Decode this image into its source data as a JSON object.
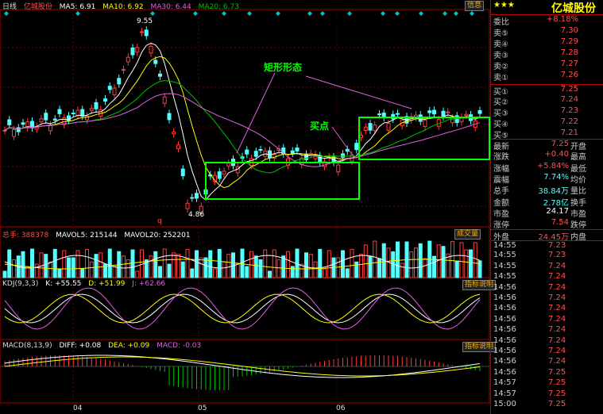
{
  "header": {
    "period": "日线",
    "stock": "亿城股份",
    "ma5": "MA5: 6.91",
    "ma10": "MA10: 6.92",
    "ma30": "MA30: 6.44",
    "ma20": "MA20: 6.73",
    "info_btn": "信息"
  },
  "annotations": {
    "pattern": "矩形形态",
    "buy": "买点",
    "high": "9.55",
    "low": "4.86",
    "q_marker": "q"
  },
  "volume_header": {
    "label": "总手: 388378",
    "mavol5": "MAVOL5: 215144",
    "mavol20": "MAVOL20: 252201",
    "btn": "成交量"
  },
  "kdj_header": {
    "label": "KDJ(9,3,3)",
    "k": "K: +55.55",
    "d": "D: +51.99",
    "j": "J: +62.66",
    "btn": "指标说明"
  },
  "macd_header": {
    "label": "MACD(8,13,9)",
    "diff": "DIFF: +0.08",
    "dea": "DEA: +0.09",
    "macd": "MACD: -0.03",
    "btn": "指标说明"
  },
  "xaxis": [
    "04",
    "05",
    "06"
  ],
  "side": {
    "stars": "★★★",
    "title": "亿城股份",
    "ratio_label": "委比",
    "ratio_value": "+8.18%",
    "asks": [
      {
        "label": "卖⑤",
        "price": "7.30"
      },
      {
        "label": "卖④",
        "price": "7.29"
      },
      {
        "label": "卖③",
        "price": "7.28"
      },
      {
        "label": "卖②",
        "price": "7.27"
      },
      {
        "label": "卖①",
        "price": "7.26"
      }
    ],
    "bids": [
      {
        "label": "买①",
        "price": "7.25"
      },
      {
        "label": "买②",
        "price": "7.24"
      },
      {
        "label": "买③",
        "price": "7.23"
      },
      {
        "label": "买④",
        "price": "7.22"
      },
      {
        "label": "买⑤",
        "price": "7.21"
      }
    ],
    "stats": [
      {
        "l1": "最新",
        "v1": "7.25",
        "l2": "开盘"
      },
      {
        "l1": "涨跌",
        "v1": "+0.40",
        "l2": "最高"
      },
      {
        "l1": "涨幅",
        "v1": "+5.84%",
        "l2": "最低"
      },
      {
        "l1": "震幅",
        "v1": "7.74%",
        "l2": "均价"
      },
      {
        "l1": "总手",
        "v1": "38.84万",
        "l2": "量比"
      },
      {
        "l1": "金额",
        "v1": "2.78亿",
        "l2": "换手"
      },
      {
        "l1": "市盈",
        "v1": "24.17",
        "l2": "市盈"
      },
      {
        "l1": "涨停",
        "v1": "7.54",
        "l2": "跌停"
      },
      {
        "l1": "外盘",
        "v1": "24.45万",
        "l2": "内盘"
      }
    ],
    "ticks": [
      {
        "time": "14:55",
        "price": "7.23"
      },
      {
        "time": "14:55",
        "price": "7.23"
      },
      {
        "time": "14:55",
        "price": "7.24"
      },
      {
        "time": "14:55",
        "price": "7.24"
      },
      {
        "time": "14:56",
        "price": "7.24"
      },
      {
        "time": "14:56",
        "price": "7.24"
      },
      {
        "time": "14:56",
        "price": "7.24"
      },
      {
        "time": "14:56",
        "price": "7.24"
      },
      {
        "time": "14:56",
        "price": "7.24"
      },
      {
        "time": "14:56",
        "price": "7.24"
      },
      {
        "time": "14:56",
        "price": "7.24"
      },
      {
        "time": "14:56",
        "price": "7.24"
      },
      {
        "time": "14:56",
        "price": "7.25"
      },
      {
        "time": "14:57",
        "price": "7.25"
      },
      {
        "time": "14:57",
        "price": "7.25"
      },
      {
        "time": "15:00",
        "price": "7.25"
      }
    ]
  },
  "colors": {
    "up": "#ff3c3c",
    "down": "#54ffff",
    "ma5": "#ffffff",
    "ma10": "#ffff00",
    "ma20": "#00c000",
    "ma30": "#e060e0",
    "box": "#00ff00"
  }
}
